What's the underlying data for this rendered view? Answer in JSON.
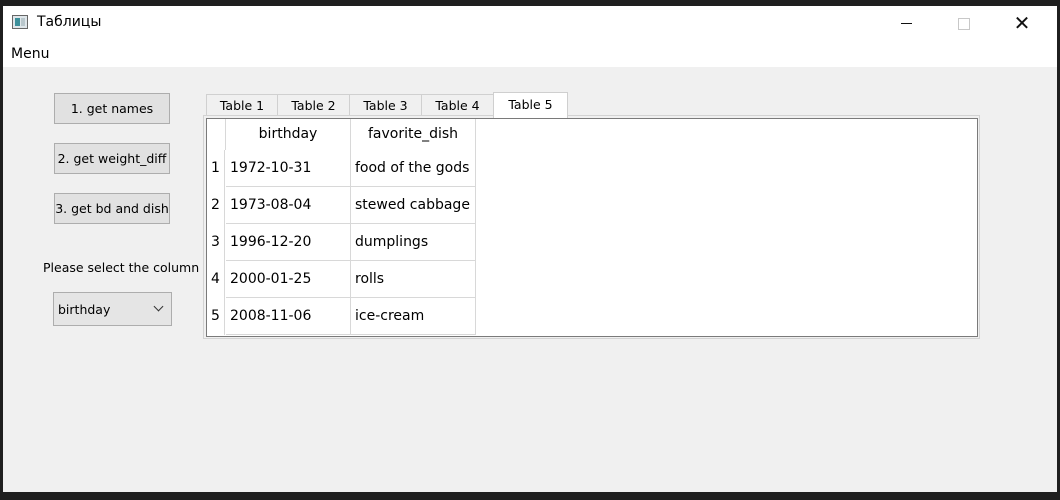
{
  "window": {
    "title": "Таблицы",
    "menu": [
      "Menu"
    ]
  },
  "left_panel": {
    "buttons": [
      "1. get names",
      "2. get weight_diff",
      "3. get bd and dish"
    ],
    "select_label": "Please select the column",
    "combo_value": "birthday"
  },
  "tabs": {
    "items": [
      "Table 1",
      "Table 2",
      "Table 3",
      "Table 4",
      "Table 5"
    ],
    "active": "Table 5"
  },
  "table": {
    "columns": [
      "birthday",
      "favorite_dish"
    ],
    "rows": [
      {
        "index": "1",
        "birthday": "1972-10-31",
        "favorite_dish": "food of the gods"
      },
      {
        "index": "2",
        "birthday": "1973-08-04",
        "favorite_dish": "stewed cabbage"
      },
      {
        "index": "3",
        "birthday": "1996-12-20",
        "favorite_dish": "dumplings"
      },
      {
        "index": "4",
        "birthday": "2000-01-25",
        "favorite_dish": "rolls"
      },
      {
        "index": "5",
        "birthday": "2008-11-06",
        "favorite_dish": "ice-cream"
      }
    ]
  }
}
